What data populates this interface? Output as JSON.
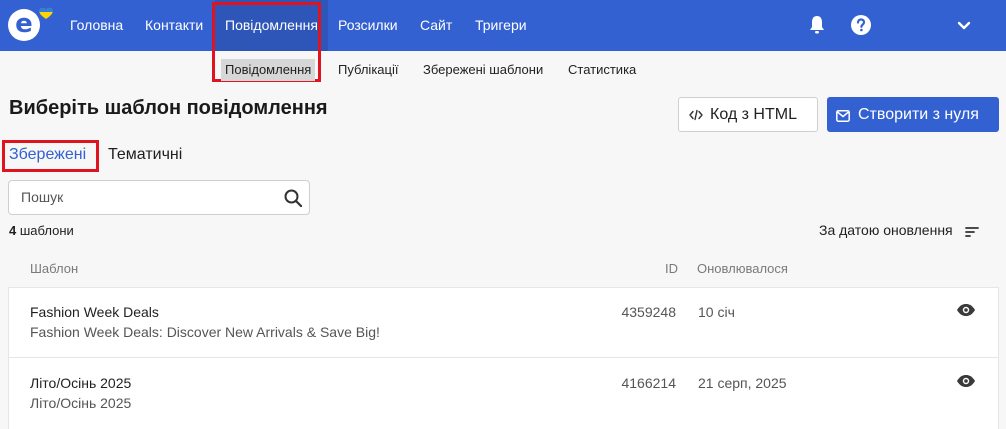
{
  "nav": {
    "logo_glyph": "e",
    "items": [
      {
        "label": "Головна"
      },
      {
        "label": "Контакти"
      },
      {
        "label": "Повідомлення"
      },
      {
        "label": "Розсилки"
      },
      {
        "label": "Сайт"
      },
      {
        "label": "Тригери"
      }
    ],
    "icons": [
      "bell-icon",
      "help-icon",
      "chevron-down-icon"
    ]
  },
  "subnav": {
    "items": [
      {
        "label": "Повідомлення"
      },
      {
        "label": "Публікації"
      },
      {
        "label": "Збережені шаблони"
      },
      {
        "label": "Статистика"
      }
    ]
  },
  "page": {
    "title": "Виберіть шаблон повідомлення",
    "html_button": "Код з HTML",
    "create_button": "Створити з нуля"
  },
  "tabs": [
    {
      "label": "Збережені"
    },
    {
      "label": "Тематичні"
    }
  ],
  "search": {
    "placeholder": "Пошук",
    "value": ""
  },
  "list": {
    "count": "4",
    "count_suffix": " шаблони",
    "sort_label": "За датою оновлення",
    "columns": {
      "template": "Шаблон",
      "id": "ID",
      "updated": "Оновлювалося"
    },
    "rows": [
      {
        "name": "Fashion Week Deals",
        "subject": "Fashion Week Deals: Discover New Arrivals & Save Big!",
        "id": "4359248",
        "updated": "10 січ"
      },
      {
        "name": "Літо/Осінь 2025",
        "subject": "Літо/Осінь 2025",
        "id": "4166214",
        "updated": "21 серп, 2025"
      }
    ]
  },
  "colors": {
    "brand": "#3361d1",
    "highlight": "#e0141e"
  }
}
